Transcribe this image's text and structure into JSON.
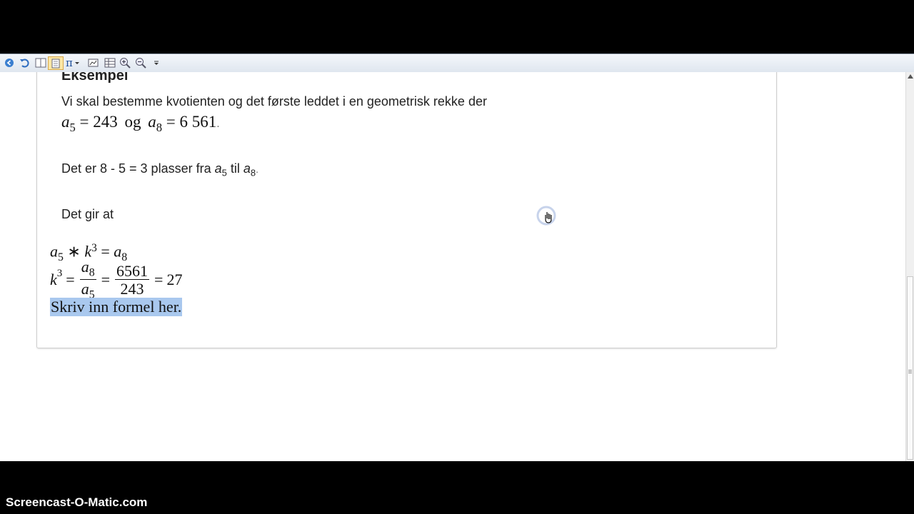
{
  "toolbar": {
    "pi_label": "π",
    "buttons": [
      "back-icon",
      "undo-icon",
      "split-view-icon",
      "page-view-icon",
      "pi-menu",
      "insert-graph-icon",
      "table-icon",
      "zoom-in-icon",
      "zoom-out-icon",
      "more-icon"
    ]
  },
  "document": {
    "heading": "Eksempel",
    "intro": "Vi skal bestemme kvotienten og det første leddet i en geometrisk rekke der",
    "given": {
      "a5_var": "a",
      "a5_index": "5",
      "a5_value": "243",
      "connector": "og",
      "a8_var": "a",
      "a8_index": "8",
      "a8_value": "6 561",
      "trailing": "."
    },
    "places": {
      "prefix": "Det er 8 - 5 = 3 plasser fra ",
      "from_var": "a",
      "from_index": "5",
      "mid": " til ",
      "to_var": "a",
      "to_index": "8",
      "suffix": "."
    },
    "gives": "Det gir at",
    "eq1": {
      "a": "a",
      "a_index": "5",
      "op": "∗",
      "k": "k",
      "exp": "3",
      "eq": "=",
      "rhs": "a",
      "rhs_index": "8"
    },
    "eq2": {
      "k": "k",
      "exp": "3",
      "eq1": "=",
      "frac1_num_var": "a",
      "frac1_num_index": "8",
      "frac1_den_var": "a",
      "frac1_den_index": "5",
      "eq2": "=",
      "frac2_num": "6561",
      "frac2_den": "243",
      "eq3": "=",
      "result": "27"
    },
    "formula_placeholder": "Skriv inn formel her."
  },
  "watermark": "Screencast-O-Matic.com",
  "colors": {
    "selection": "#a9c8ee",
    "toolbar_bg": "#e6ecf3",
    "text": "#222222"
  }
}
